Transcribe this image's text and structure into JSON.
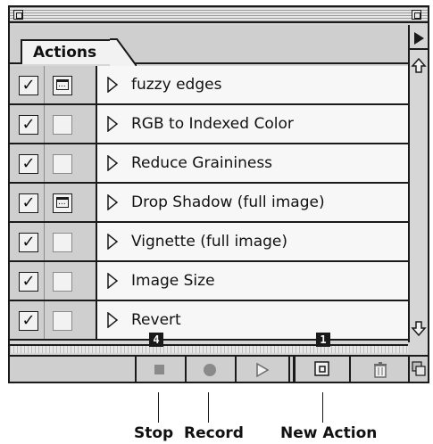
{
  "panel": {
    "tab_label": "Actions",
    "actions": [
      {
        "label": "fuzzy edges",
        "checked": true,
        "dialog": true
      },
      {
        "label": "RGB to Indexed Color",
        "checked": true,
        "dialog": false
      },
      {
        "label": "Reduce Graininess",
        "checked": true,
        "dialog": false
      },
      {
        "label": "Drop Shadow (full image)",
        "checked": true,
        "dialog": true
      },
      {
        "label": "Vignette (full image)",
        "checked": true,
        "dialog": false
      },
      {
        "label": "Image Size",
        "checked": true,
        "dialog": false
      },
      {
        "label": "Revert",
        "checked": true,
        "dialog": false
      }
    ],
    "check_glyph": "✓"
  },
  "toolbar": {
    "badges": [
      "4",
      "1"
    ],
    "icons": [
      "stop-icon",
      "record-icon",
      "play-icon",
      "new-action-icon",
      "trash-icon",
      "new-set-icon"
    ]
  },
  "callouts": [
    "Stop",
    "Record",
    "New Action"
  ]
}
